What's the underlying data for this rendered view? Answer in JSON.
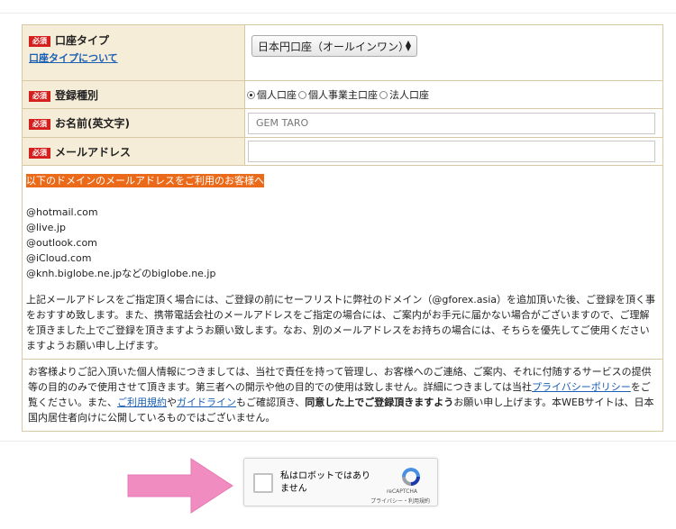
{
  "form": {
    "required_badge": "必須",
    "account_type": {
      "label": "口座タイプ",
      "help_link": "口座タイプについて",
      "selected": "日本円口座（オールインワン）"
    },
    "registration_type": {
      "label": "登録種別",
      "options": [
        "個人口座",
        "個人事業主口座",
        "法人口座"
      ],
      "selected_index": 0
    },
    "name": {
      "label": "お名前(英文字)",
      "placeholder": "GEM TARO"
    },
    "email": {
      "label": "メールアドレス",
      "value": ""
    }
  },
  "notice": {
    "highlight": "以下のドメインのメールアドレスをご利用のお客様へ",
    "domains": [
      "@hotmail.com",
      "@live.jp",
      "@outlook.com",
      "@iCloud.com",
      "@knh.biglobe.ne.jpなどのbiglobe.ne.jp"
    ],
    "body": "上記メールアドレスをご指定頂く場合には、ご登録の前にセーフリストに弊社のドメイン（@gforex.asia）を追加頂いた後、ご登録を頂く事をおすすめ致します。また、携帯電話会社のメールアドレスをご指定の場合には、ご案内がお手元に届かない場合がございますので、ご理解を頂きました上でご登録を頂きますようお願い致します。なお、別のメールアドレスをお持ちの場合には、そちらを優先してご使用くださいますようお願い申し上げます。"
  },
  "privacy": {
    "text1": "お客様よりご記入頂いた個人情報につきましては、当社で責任を持って管理し、お客様へのご連絡、ご案内、それに付随するサービスの提供等の目的のみで使用させて頂きます。第三者への開示や他の目的での使用は致しません。詳細につきましては当社",
    "privacy_link": "プライバシーポリシー",
    "text2": "をご覧ください。また、",
    "terms_link": "ご利用規約",
    "text3": "や",
    "guideline_link": "ガイドライン",
    "text4": "もご確認頂き、",
    "bold": "同意した上でご登録頂きますよう",
    "text5": "お願い申し上げます。本WEBサイトは、日本国内居住者向けに公開しているものではございません。"
  },
  "captcha": {
    "label": "私はロボットではありません",
    "brand": "reCAPTCHA",
    "links": "プライバシー・利用規約"
  },
  "colors": {
    "label_bg": "#f6edd8",
    "border": "#d7c9a6",
    "required": "#d4201e",
    "highlight": "#ea6a1a",
    "link": "#1a5fb4",
    "arrow": "#f08cc0"
  }
}
